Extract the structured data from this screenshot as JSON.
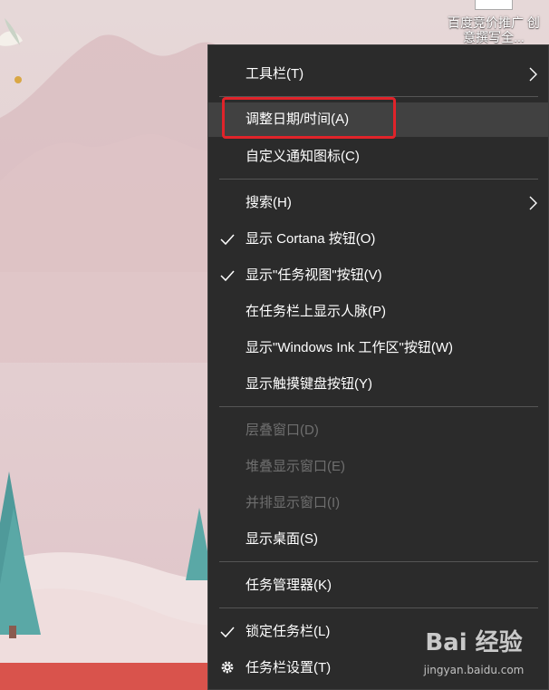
{
  "desktop": {
    "shortcut": {
      "label": "百度竞价推广 创意撰写全..."
    }
  },
  "context_menu": {
    "items": [
      {
        "label": "工具栏(T)",
        "submenu": true
      },
      {
        "label": "调整日期/时间(A)",
        "hover": true
      },
      {
        "label": "自定义通知图标(C)"
      },
      {
        "label": "搜索(H)",
        "submenu": true
      },
      {
        "label": "显示 Cortana 按钮(O)",
        "checked": true
      },
      {
        "label": "显示\"任务视图\"按钮(V)",
        "checked": true
      },
      {
        "label": "在任务栏上显示人脉(P)"
      },
      {
        "label": "显示\"Windows Ink 工作区\"按钮(W)"
      },
      {
        "label": "显示触摸键盘按钮(Y)"
      },
      {
        "label": "层叠窗口(D)",
        "disabled": true
      },
      {
        "label": "堆叠显示窗口(E)",
        "disabled": true
      },
      {
        "label": "并排显示窗口(I)",
        "disabled": true
      },
      {
        "label": "显示桌面(S)"
      },
      {
        "label": "任务管理器(K)"
      },
      {
        "label": "锁定任务栏(L)",
        "checked": true
      },
      {
        "label": "任务栏设置(T)",
        "icon": "gear-icon"
      }
    ]
  },
  "annotation": {
    "highlight_color": "#e0232a"
  },
  "watermark": {
    "logo_text": "Bai 经验",
    "url": "jingyan.baidu.com"
  },
  "colors": {
    "menu_bg": "#2b2b2b",
    "menu_hover": "#414141",
    "menu_text": "#ffffff",
    "menu_disabled_text": "#6f6f6f",
    "separator": "#555555"
  }
}
